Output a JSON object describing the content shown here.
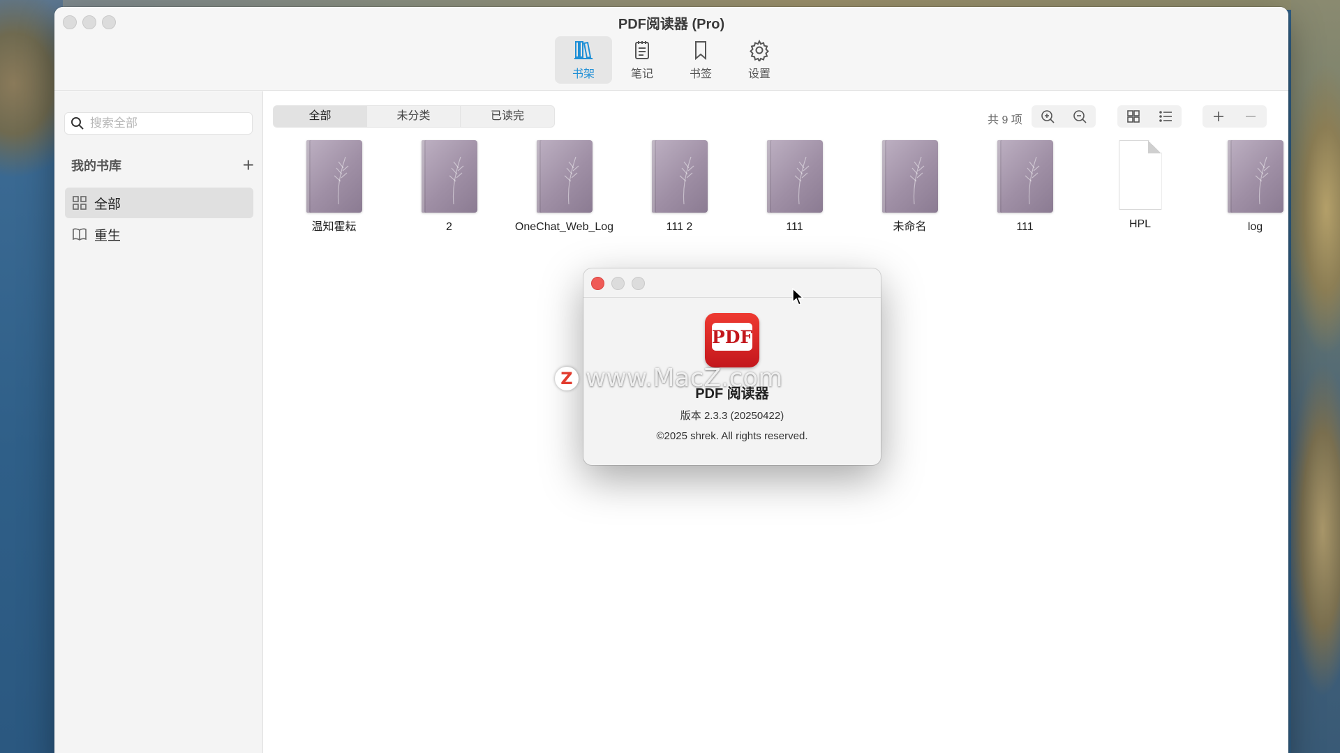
{
  "window": {
    "title": "PDF阅读器 (Pro)"
  },
  "toolbar": {
    "items": [
      {
        "label": "书架",
        "icon": "bookshelf-icon",
        "active": true
      },
      {
        "label": "笔记",
        "icon": "notes-icon",
        "active": false
      },
      {
        "label": "书签",
        "icon": "bookmark-icon",
        "active": false
      },
      {
        "label": "设置",
        "icon": "gear-icon",
        "active": false
      }
    ]
  },
  "sidebar": {
    "search_placeholder": "搜索全部",
    "library_title": "我的书库",
    "add_label": "+",
    "items": [
      {
        "label": "全部",
        "icon": "grid-icon",
        "selected": true
      },
      {
        "label": "重生",
        "icon": "book-open-icon",
        "selected": false
      }
    ]
  },
  "content": {
    "filters": [
      "全部",
      "未分类",
      "已读完"
    ],
    "active_filter": "全部",
    "count_text": "共 9 项",
    "books": [
      {
        "name": "温知霍耘",
        "kind": "book"
      },
      {
        "name": "2",
        "kind": "book"
      },
      {
        "name": "OneChat_Web_Log",
        "kind": "book"
      },
      {
        "name": "111 2",
        "kind": "book"
      },
      {
        "name": "111",
        "kind": "book"
      },
      {
        "name": "未命名",
        "kind": "book"
      },
      {
        "name": "111",
        "kind": "book"
      },
      {
        "name": "HPL",
        "kind": "document"
      },
      {
        "name": "log",
        "kind": "book"
      }
    ]
  },
  "about_dialog": {
    "app_icon_text": "PDF",
    "app_name": "PDF 阅读器",
    "version": "版本 2.3.3 (20250422)",
    "copyright": "©2025 shrek. All rights reserved."
  },
  "watermark": {
    "logo": "Z",
    "text": "www.MacZ.com"
  },
  "colors": {
    "accent": "#1e8fd6",
    "close_red": "#ef5b57",
    "app_icon_red": "#d3221f",
    "book_cover": "#9f8fa5"
  }
}
